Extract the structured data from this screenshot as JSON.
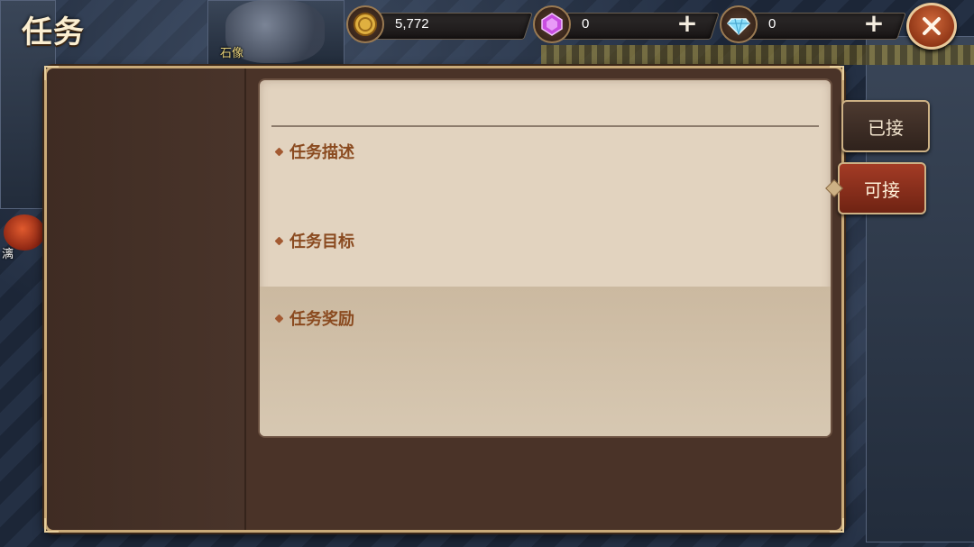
{
  "page": {
    "title": "任务"
  },
  "map": {
    "label_statue": "石像",
    "label_left": "漓"
  },
  "currencies": [
    {
      "name": "gold-coin",
      "value": "5,772",
      "has_plus": false,
      "color": "#d8a93a"
    },
    {
      "name": "purple-gem",
      "value": "0",
      "has_plus": true,
      "color": "#c04ad8"
    },
    {
      "name": "diamond",
      "value": "0",
      "has_plus": true,
      "color": "#7fd4f4"
    }
  ],
  "plus_symbol": "+",
  "sections": {
    "description": "任务描述",
    "objective": "任务目标",
    "reward": "任务奖励"
  },
  "tabs": {
    "accepted": "已接",
    "available": "可接",
    "active": "available"
  },
  "colors": {
    "panel": "#4a3328",
    "panel_border": "#c9aa78",
    "card": "#e2d3bf",
    "section_text": "#8a4a1f",
    "active_tab": "#a33b25"
  }
}
